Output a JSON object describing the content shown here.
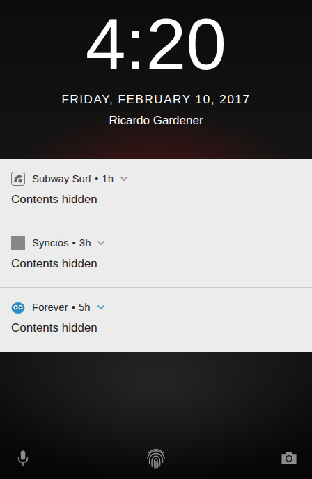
{
  "clock": {
    "time": "4:20",
    "date": "FRIDAY, FEBRUARY 10, 2017",
    "owner": "Ricardo Gardener"
  },
  "notifications": [
    {
      "app": "Subway Surf",
      "separator": "•",
      "age": "1h",
      "content": "Contents hidden",
      "expanded": false,
      "color": "#8a8a8a"
    },
    {
      "app": "Syncios",
      "separator": "•",
      "age": "3h",
      "content": "Contents hidden",
      "expanded": false,
      "color": "#8a8a8a"
    },
    {
      "app": "Forever",
      "separator": "•",
      "age": "5h",
      "content": "Contents hidden",
      "expanded": false,
      "color": "#2a8fc7"
    }
  ]
}
